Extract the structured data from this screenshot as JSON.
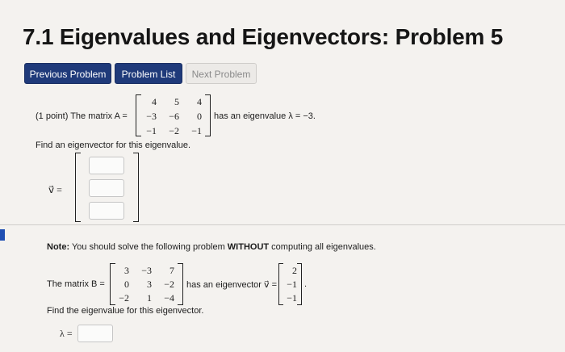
{
  "page": {
    "title": "7.1 Eigenvalues and Eigenvectors: Problem 5"
  },
  "nav": {
    "previous_label": "Previous Problem",
    "list_label": "Problem List",
    "next_label": "Next Problem"
  },
  "problem1": {
    "intro": "(1 point) The matrix A =",
    "suffix": "has an eigenvalue λ = −3.",
    "matrix": [
      [
        "4",
        "5",
        "4"
      ],
      [
        "−3",
        "−6",
        "0"
      ],
      [
        "−1",
        "−2",
        "−1"
      ]
    ],
    "instruction": "Find an eigenvector for this eigenvalue.",
    "vector_label": "v⃗ ="
  },
  "problem2": {
    "note_label": "Note:",
    "note_text": " You should solve the following problem ",
    "note_bold": "WITHOUT",
    "note_end": " computing all eigenvalues.",
    "intro": "The matrix B =",
    "matrix": [
      [
        "3",
        "−3",
        "7"
      ],
      [
        "0",
        "3",
        "−2"
      ],
      [
        "−2",
        "1",
        "−4"
      ]
    ],
    "mid": "has an eigenvector v⃗ =",
    "vector": [
      "2",
      "−1",
      "−1"
    ],
    "end_punct": ".",
    "instruction": "Find the eigenvalue for this eigenvector.",
    "lambda_label": "λ ="
  },
  "colors": {
    "primary_button": "#1f3a7a",
    "page_background": "#f4f2ef"
  }
}
